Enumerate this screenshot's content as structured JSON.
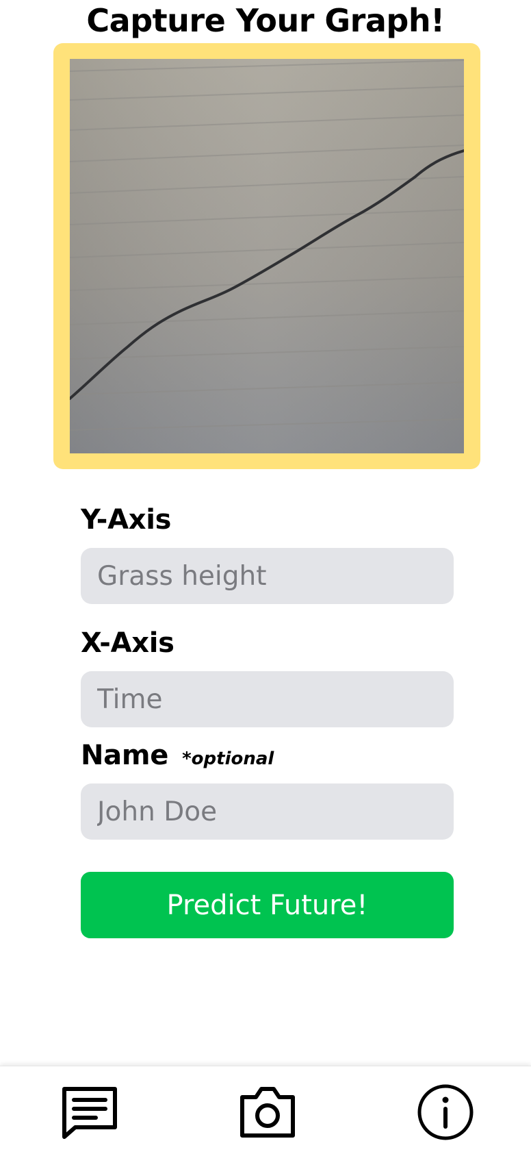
{
  "header": {
    "title": "Capture Your Graph!"
  },
  "capture": {
    "frame_color": "#FFE27A"
  },
  "form": {
    "y_axis": {
      "label": "Y-Axis",
      "placeholder": "Grass height"
    },
    "x_axis": {
      "label": "X-Axis",
      "placeholder": "Time"
    },
    "name": {
      "label": "Name",
      "note": "*optional",
      "placeholder": "John Doe"
    },
    "submit_label": "Predict Future!",
    "submit_color": "#00C350"
  },
  "bottom_nav": {
    "items": [
      {
        "icon": "chat-icon"
      },
      {
        "icon": "camera-icon"
      },
      {
        "icon": "info-icon"
      }
    ]
  }
}
